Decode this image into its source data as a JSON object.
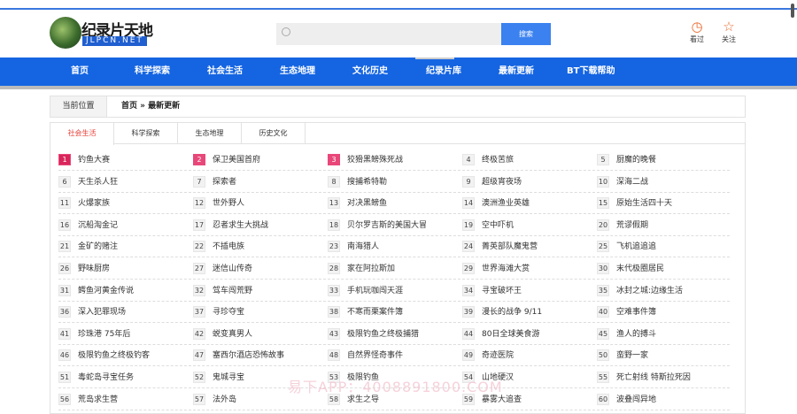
{
  "header": {
    "logo_text": "纪录片天地",
    "logo_sub": "JLPCN.NET",
    "search_placeholder": "",
    "search_button": "搜索",
    "history_label": "看过",
    "follow_label": "关注",
    "history_icon": "clock-icon",
    "follow_icon": "star-icon",
    "accent": "#1565e2"
  },
  "nav": [
    "首页",
    "科学探索",
    "社会生活",
    "生态地理",
    "文化历史",
    "纪录片库",
    "最新更新",
    "BT下载帮助"
  ],
  "breadcrumb": {
    "label": "当前位置",
    "path": "首页 » 最新更新"
  },
  "tabs": [
    {
      "label": "社会生活",
      "active": true
    },
    {
      "label": "科学探索"
    },
    {
      "label": "生态地理"
    },
    {
      "label": "历史文化"
    }
  ],
  "items": [
    "钓鱼大赛",
    "保卫美国首府",
    "狡猾黑鳑殊死战",
    "终极苦旅",
    "厨魔的晚餐",
    "天生杀人狂",
    "探索者",
    "搜捕希特勒",
    "超级宵夜场",
    "深海二战",
    "火爆家族",
    "世外野人",
    "对决黑鳑鱼",
    "澳洲渔业英雄",
    "原始生活四十天",
    "沉船淘金记",
    "忍者求生大挑战",
    "贝尔罗吉斯的美国大冒",
    "空中吓机",
    "荒谬假期",
    "金矿的赌注",
    "不插电族",
    "南海猎人",
    "菁英部队魔鬼营",
    "飞机追追追",
    "野味厨房",
    "迷信山传奇",
    "家在阿拉斯加",
    "世界海滩大赏",
    "末代极圈居民",
    "鳄鱼河黄金传说",
    "驾车闯荒野",
    "手机玩咖闯天涯",
    "寻宝破坏王",
    "冰封之城:边缘生活",
    "深入犯罪现场",
    "寻珍夺宝",
    "不寒而栗案件簿",
    "漫长的战争 9/11",
    "空难事件簿",
    "珍珠港 75年后",
    "蜕变真男人",
    "极限钓鱼之终极捕猎",
    "80日全球美食游",
    "渔人的搏斗",
    "极限钓鱼之终极钓客",
    "塞西尔酒店恐怖故事",
    "自然界怪奇事件",
    "奇迹医院",
    "蛮野一家",
    "毒蛇岛寻宝任务",
    "鬼城寻宝",
    "极限钓鱼",
    "山地硬汉",
    "死亡射线 特斯拉死因",
    "荒岛求生营",
    "法外岛",
    "求生之导",
    "暴雾大追查",
    "波叠闯异地"
  ],
  "watermark": "易下APP：4008891800.COM"
}
